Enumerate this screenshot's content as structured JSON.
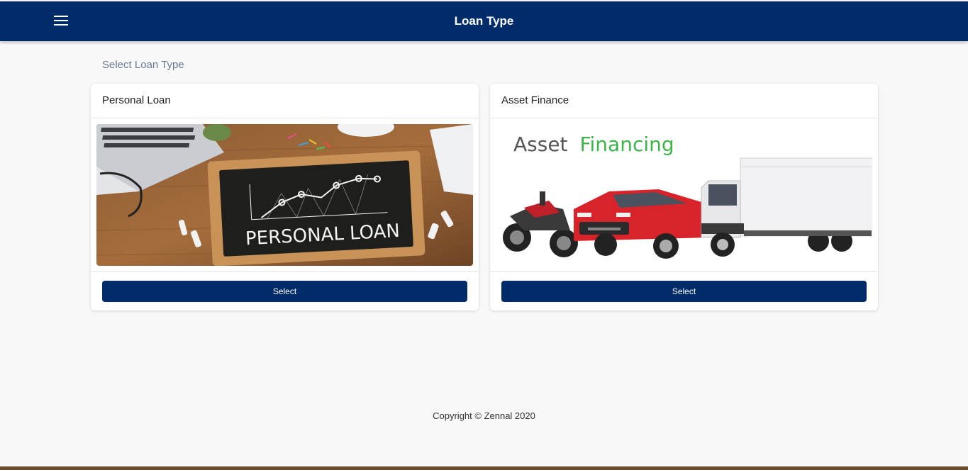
{
  "header": {
    "title": "Loan Type",
    "menu_icon": "hamburger-menu-icon",
    "background": "#022b69"
  },
  "main": {
    "section_label": "Select Loan Type",
    "cards": [
      {
        "title": "Personal Loan",
        "image_text": "PERSONAL LOAN",
        "button_label": "Select"
      },
      {
        "title": "Asset Finance",
        "image_text_part1": "Asset",
        "image_text_part2": "Financing",
        "button_label": "Select"
      }
    ]
  },
  "footer": {
    "copyright": "Copyright © Zennal 2020"
  },
  "colors": {
    "primary": "#022b69",
    "page_bg": "#f8f8f8",
    "financing_green": "#3cb44a"
  }
}
